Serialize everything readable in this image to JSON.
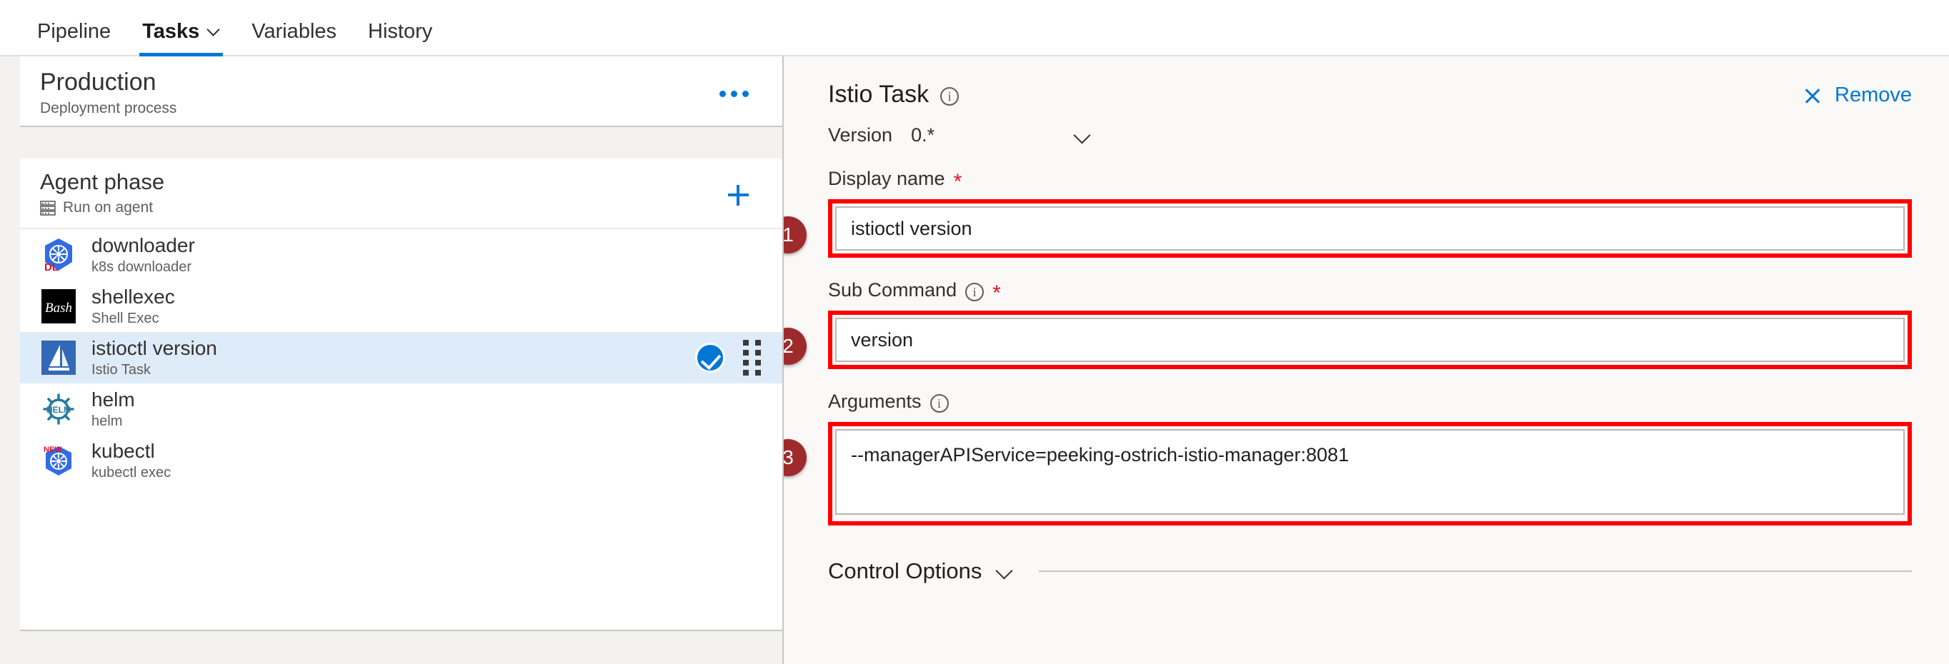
{
  "nav": {
    "tabs": [
      {
        "label": "Pipeline",
        "active": false,
        "caret": false
      },
      {
        "label": "Tasks",
        "active": true,
        "caret": true
      },
      {
        "label": "Variables",
        "active": false,
        "caret": false
      },
      {
        "label": "History",
        "active": false,
        "caret": false
      }
    ]
  },
  "process": {
    "title": "Production",
    "subtitle": "Deployment process",
    "overflow_icon": "ellipsis-icon"
  },
  "phase": {
    "title": "Agent phase",
    "subtitle": "Run on agent",
    "icon": "server-icon",
    "add_icon": "plus-icon"
  },
  "tasks": [
    {
      "name": "downloader",
      "desc": "k8s downloader",
      "icon": "kubernetes-downloader-icon",
      "selected": false
    },
    {
      "name": "shellexec",
      "desc": "Shell Exec",
      "icon": "bash-icon",
      "selected": false
    },
    {
      "name": "istioctl version",
      "desc": "Istio Task",
      "icon": "istio-icon",
      "selected": true
    },
    {
      "name": "helm",
      "desc": "helm",
      "icon": "helm-icon",
      "selected": false
    },
    {
      "name": "kubectl",
      "desc": "kubectl exec",
      "icon": "kubernetes-new-icon",
      "selected": false
    }
  ],
  "details": {
    "title": "Istio Task",
    "title_info_icon": "info-icon",
    "remove_label": "Remove",
    "remove_icon": "close-icon",
    "version_label": "Version",
    "version_value": "0.*",
    "version_chevron_icon": "chevron-down-icon",
    "fields": [
      {
        "label": "Display name",
        "required": true,
        "info": false,
        "value": "istioctl version",
        "badge": "1",
        "type": "input"
      },
      {
        "label": "Sub Command",
        "required": true,
        "info": true,
        "value": "version",
        "badge": "2",
        "type": "input"
      },
      {
        "label": "Arguments",
        "required": false,
        "info": true,
        "value": "--managerAPIService=peeking-ostrich-istio-manager:8081",
        "badge": "3",
        "type": "textarea"
      }
    ],
    "control_options_label": "Control Options",
    "control_options_chevron_icon": "chevron-down-icon"
  },
  "colors": {
    "accent": "#0078d4",
    "selected_row": "#deecf9",
    "annotation": "#ff0000",
    "badge": "#9e2a2b",
    "required": "#e81123",
    "panel_bg": "#faf9f8"
  }
}
